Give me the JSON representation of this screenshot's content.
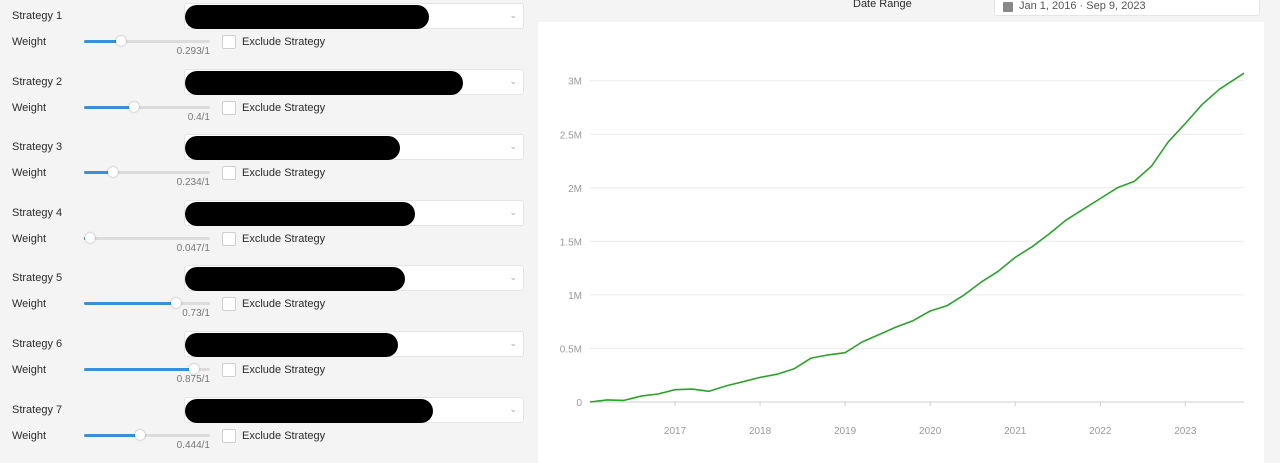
{
  "strategies": [
    {
      "label": "Strategy 1",
      "weight_label": "Weight",
      "weight": 0.293,
      "weight_text": "0.293/1",
      "exclude_label": "Exclude Strategy",
      "redact_width": 244
    },
    {
      "label": "Strategy 2",
      "weight_label": "Weight",
      "weight": 0.4,
      "weight_text": "0.4/1",
      "exclude_label": "Exclude Strategy",
      "redact_width": 278
    },
    {
      "label": "Strategy 3",
      "weight_label": "Weight",
      "weight": 0.234,
      "weight_text": "0.234/1",
      "exclude_label": "Exclude Strategy",
      "redact_width": 215
    },
    {
      "label": "Strategy 4",
      "weight_label": "Weight",
      "weight": 0.047,
      "weight_text": "0.047/1",
      "exclude_label": "Exclude Strategy",
      "redact_width": 230
    },
    {
      "label": "Strategy 5",
      "weight_label": "Weight",
      "weight": 0.73,
      "weight_text": "0.73/1",
      "exclude_label": "Exclude Strategy",
      "redact_width": 220
    },
    {
      "label": "Strategy 6",
      "weight_label": "Weight",
      "weight": 0.875,
      "weight_text": "0.875/1",
      "exclude_label": "Exclude Strategy",
      "redact_width": 213
    },
    {
      "label": "Strategy 7",
      "weight_label": "Weight",
      "weight": 0.444,
      "weight_text": "0.444/1",
      "exclude_label": "Exclude Strategy",
      "redact_width": 248
    }
  ],
  "date_range": {
    "label": "Date Range",
    "value": "Jan 1, 2016  ·  Sep 9, 2023",
    "icon": "calendar-icon"
  },
  "colors": {
    "accent": "#3a8fd9",
    "line": "#2ea02e"
  },
  "chart_data": {
    "type": "line",
    "title": "",
    "xlabel": "",
    "ylabel": "",
    "xlim": [
      2016.0,
      2023.69
    ],
    "ylim": [
      0,
      3100000
    ],
    "x_ticks": [
      2017,
      2018,
      2019,
      2020,
      2021,
      2022,
      2023
    ],
    "x_tick_labels": [
      "2017",
      "2018",
      "2019",
      "2020",
      "2021",
      "2022",
      "2023"
    ],
    "y_ticks": [
      0,
      500000,
      1000000,
      1500000,
      2000000,
      2500000,
      3000000
    ],
    "y_tick_labels": [
      "0",
      "0.5M",
      "1M",
      "1.5M",
      "2M",
      "2.5M",
      "3M"
    ],
    "grid": true,
    "series": [
      {
        "x": [
          2016.0,
          2016.2,
          2016.4,
          2016.6,
          2016.8,
          2017.0,
          2017.2,
          2017.4,
          2017.6,
          2017.8,
          2018.0,
          2018.2,
          2018.4,
          2018.6,
          2018.8,
          2019.0,
          2019.2,
          2019.4,
          2019.6,
          2019.8,
          2020.0,
          2020.2,
          2020.4,
          2020.6,
          2020.8,
          2021.0,
          2021.2,
          2021.4,
          2021.6,
          2021.8,
          2022.0,
          2022.2,
          2022.4,
          2022.6,
          2022.8,
          2023.0,
          2023.2,
          2023.4,
          2023.69
        ],
        "y": [
          0,
          20000,
          15000,
          55000,
          75000,
          115000,
          120000,
          100000,
          150000,
          190000,
          230000,
          260000,
          310000,
          410000,
          440000,
          460000,
          560000,
          630000,
          700000,
          760000,
          850000,
          900000,
          1000000,
          1120000,
          1220000,
          1350000,
          1450000,
          1570000,
          1700000,
          1800000,
          1900000,
          2000000,
          2060000,
          2200000,
          2430000,
          2600000,
          2780000,
          2920000,
          3070000
        ]
      }
    ]
  }
}
